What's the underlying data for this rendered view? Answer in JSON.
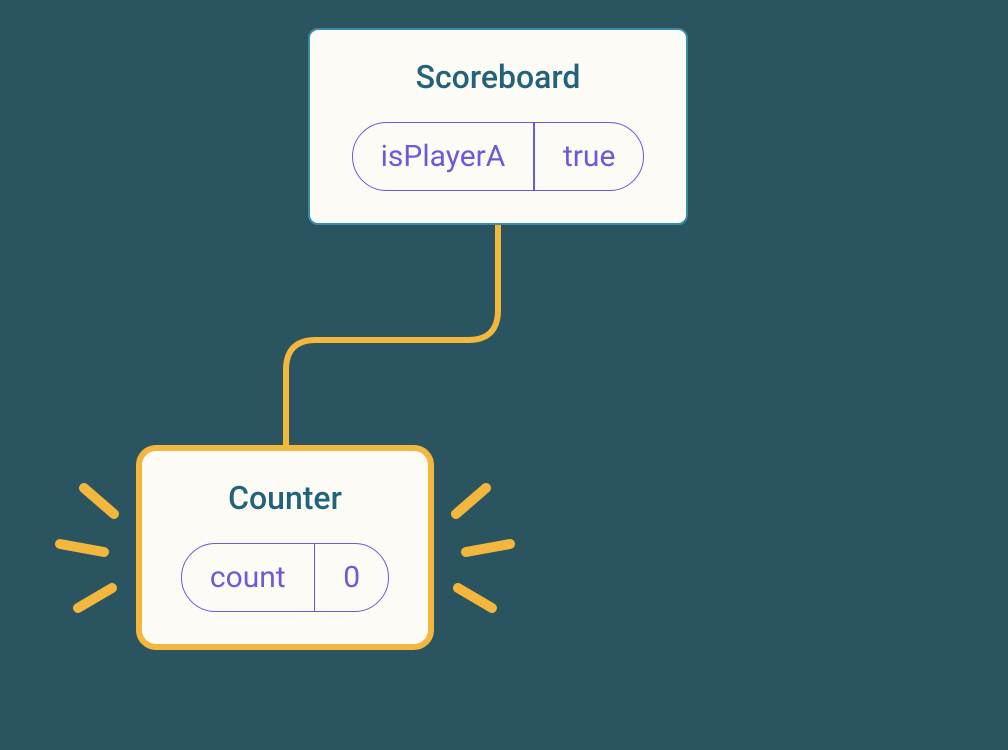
{
  "parent": {
    "title": "Scoreboard",
    "state": {
      "key": "isPlayerA",
      "value": "true"
    }
  },
  "child": {
    "title": "Counter",
    "state": {
      "key": "count",
      "value": "0"
    }
  },
  "colors": {
    "background": "#2a5560",
    "nodeFill": "#fcfbf6",
    "parentBorder": "#3a8ba6",
    "childBorder": "#f4b73e",
    "title": "#23627a",
    "pill": "#6b5bd6",
    "connector": "#f4b73e"
  }
}
